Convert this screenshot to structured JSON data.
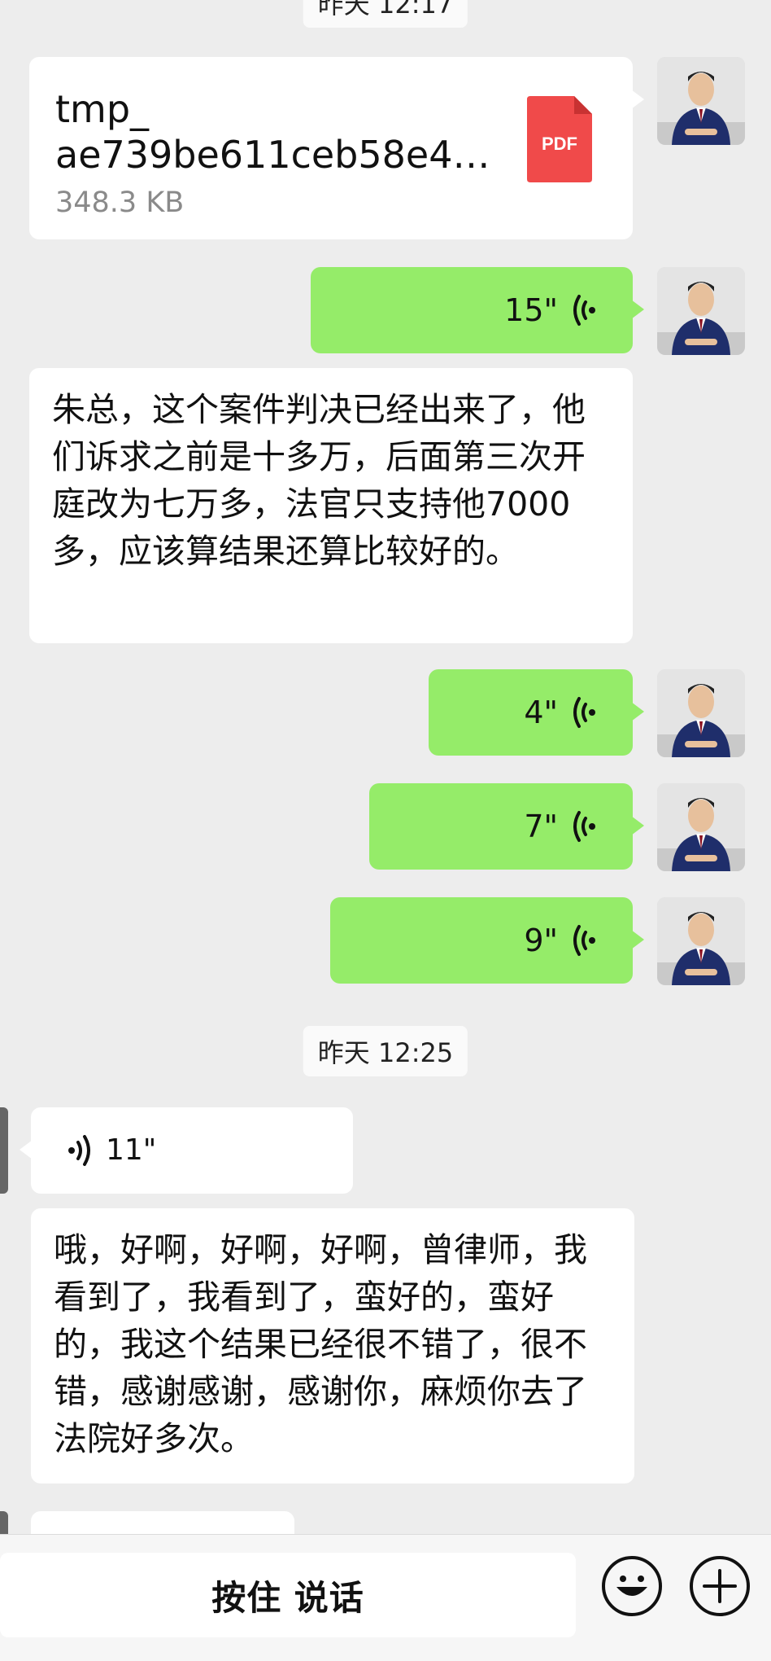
{
  "timestamps": {
    "top": "昨天 12:17",
    "middle": "昨天 12:25"
  },
  "file_message": {
    "name": "tmp_ ae739be611ceb58e4…",
    "size": "348.3 KB",
    "type_label": "PDF"
  },
  "voice_out": [
    {
      "duration": "15\""
    },
    {
      "duration": "4\""
    },
    {
      "duration": "7\""
    },
    {
      "duration": "9\""
    }
  ],
  "text_in_1": "朱总，这个案件判决已经出来了，他们诉求之前是十多万，后面第三次开庭改为七万多，法官只支持他7000多，应该算结果还算比较好的。",
  "voice_in": {
    "duration": "11\""
  },
  "text_in_2": "哦，好啊，好啊，好啊，曾律师，我看到了，我看到了，蛮好的，蛮好的，我这个结果已经很不错了，很不错，感谢感谢，感谢你，麻烦你去了法院好多次。",
  "input_bar": {
    "hold_to_talk": "按住 说话"
  },
  "icons": {
    "emoji": "emoji-icon",
    "plus": "plus-icon",
    "voice_wave": "voice-wave-icon",
    "pdf": "pdf-file-icon"
  },
  "colors": {
    "background": "#ededed",
    "bubble_out": "#95ec69",
    "bubble_in": "#ffffff",
    "pdf_red": "#f04a4a"
  }
}
